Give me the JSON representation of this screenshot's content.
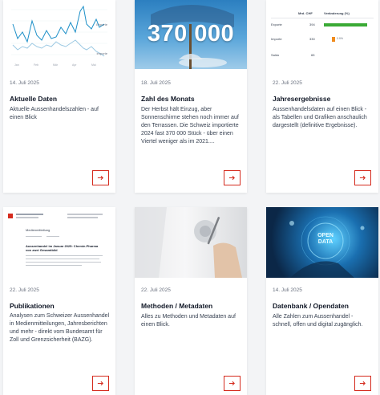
{
  "cards": [
    {
      "date": "14. Juli 2025",
      "title": "Aktuelle Daten",
      "desc": "Aktuelle Aussenhandelszahlen - auf einen Blick",
      "chart": {
        "yticks": [
          "",
          "",
          "",
          "",
          ""
        ],
        "xticks": [
          "Jan",
          "Feb",
          "Mär",
          "Apr",
          "Mai"
        ],
        "legend": [
          "Exporte",
          "Importe"
        ]
      }
    },
    {
      "date": "18. Juli 2025",
      "title": "Zahl des Monats",
      "big_number": "370 000",
      "desc": "Der Herbst hält Einzug, aber Sonnenschirme stehen noch immer auf den Terrassen. Die Schweiz importierte 2024 fast 370 000 Stück - über einen Viertel weniger als im 2021...."
    },
    {
      "date": "22. Juli 2025",
      "title": "Jahresergebnisse",
      "desc": "Aussenhandelsdaten auf einen Blick - als Tabellen und Grafiken anschaulich dargestellt (definitive Ergebnisse).",
      "table": {
        "col1": "Mrd. CHF",
        "col2": "Veränderung (%)",
        "rows": [
          {
            "label": "Exporte",
            "value": "394",
            "change": "",
            "bar": 1.0
          },
          {
            "label": "Importe",
            "value": "330",
            "change": "0.9%",
            "bar": 0.08
          },
          {
            "label": "Saldo",
            "value": "65",
            "change": "",
            "bar": 0
          }
        ]
      }
    },
    {
      "date": "22. Juli 2025",
      "title": "Publikationen",
      "desc": "Analysen zum Schweizer Aussenhandel in Medienmitteilungen, Jahresberichten und mehr - direkt vom Bundesamt für Zoll und Grenzsicherheit (BAZG).",
      "doc": {
        "heading": "Medienmitteilung",
        "headline": "Aussenhandel im Januar 2025: Chemie-Pharma von zwei Gesamtbild"
      }
    },
    {
      "date": "22. Juli 2025",
      "title": "Methoden / Metadaten",
      "desc": "Alles zu Methoden und Metadaten auf einen Blick."
    },
    {
      "date": "14. Juli 2025",
      "title": "Datenbank / Opendaten",
      "desc": "Alle Zahlen zum Aussenhandel - schnell, offen und digital zugänglich.",
      "badge": "OPEN DATA"
    }
  ],
  "colors": {
    "accent": "#d52b1e",
    "line_export": "#1e90c8",
    "line_import": "#9cc9e3"
  }
}
